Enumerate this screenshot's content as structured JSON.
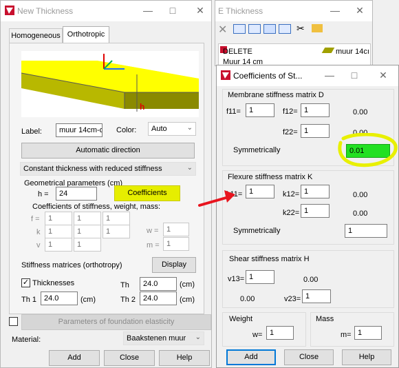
{
  "left_window": {
    "title": "New Thickness",
    "tabs": [
      "Homogeneous",
      "Orthotropic"
    ],
    "label_caption": "Label:",
    "label_value": "muur 14cm-c",
    "color_caption": "Color:",
    "color_value": "Auto",
    "auto_direction_label": "Automatic direction",
    "thickness_type": "Constant thickness with reduced stiffness",
    "geom_params_title": "Geometrical parameters (cm)",
    "h_caption": "h  =",
    "h_value": "24",
    "coefficients_label": "Coefficients",
    "coef_title": "Coefficients of stiffness, weight, mass:",
    "f_caption": "f =",
    "k_caption": "k",
    "v_caption": "v",
    "row_f": [
      "1",
      "1",
      "1"
    ],
    "row_k": [
      "1",
      "1",
      "1"
    ],
    "row_v": [
      "1",
      "1"
    ],
    "w_caption": "w =",
    "w_value": "1",
    "m_caption": "m =",
    "m_value": "1",
    "stiffness_caption": "Stiffness matrices (orthotropy)",
    "display_label": "Display",
    "thicknesses_label": "Thicknesses",
    "th_caption": "Th",
    "th_value": "24.0",
    "th_unit": "(cm)",
    "th1_caption": "Th 1",
    "th1_value": "24.0",
    "th1_unit": "(cm)",
    "th2_caption": "Th 2",
    "th2_value": "24.0",
    "th2_unit": "(cm)",
    "foundation_label": "Parameters of foundation elasticity",
    "material_caption": "Material:",
    "material_value": "Baakstenen muur",
    "add_label": "Add",
    "close_label": "Close",
    "help_label": "Help",
    "h_marker": "h"
  },
  "middle_window": {
    "title": "E Thickness",
    "list_items": [
      "DELETE",
      "Muur 14 cm"
    ],
    "list_item_right": "muur 14cı"
  },
  "right_window": {
    "title": "Coefficients of St...",
    "membrane_title": "Membrane stiffness matrix D",
    "f11_caption": "f11=",
    "f11_value": "1",
    "f12_caption": "f12=",
    "f12_value": "1",
    "f22_caption": "f22=",
    "f22_value": "1",
    "m_zero_a": "0.00",
    "m_zero_b": "0.00",
    "symmetrically_caption": "Symmetrically",
    "membrane_sym_value": "0.01",
    "flexure_title": "Flexure stiffness matrix K",
    "k11_caption": "k11=",
    "k11_value": "1",
    "k12_caption": "k12=",
    "k12_value": "1",
    "k22_caption": "k22=",
    "k22_value": "1",
    "k_zero_a": "0.00",
    "k_zero_b": "0.00",
    "flexure_sym_value": "1",
    "shear_title": "Shear stiffness matrix H",
    "v13_caption": "v13=",
    "v13_value": "1",
    "v23_caption": "v23=",
    "v23_value": "1",
    "s_zero_a": "0.00",
    "s_zero_b": "0.00",
    "weight_title": "Weight",
    "w_caption": "w=",
    "w_value": "1",
    "mass_title": "Mass",
    "m_caption": "m=",
    "m_value": "1",
    "add_label": "Add",
    "close_label": "Close",
    "help_label": "Help"
  },
  "colors": {
    "highlight_yellow": "#e8f000",
    "field_green": "#22e022",
    "arrow_red": "#e8141e",
    "plate_yellow": "#ffff00"
  }
}
